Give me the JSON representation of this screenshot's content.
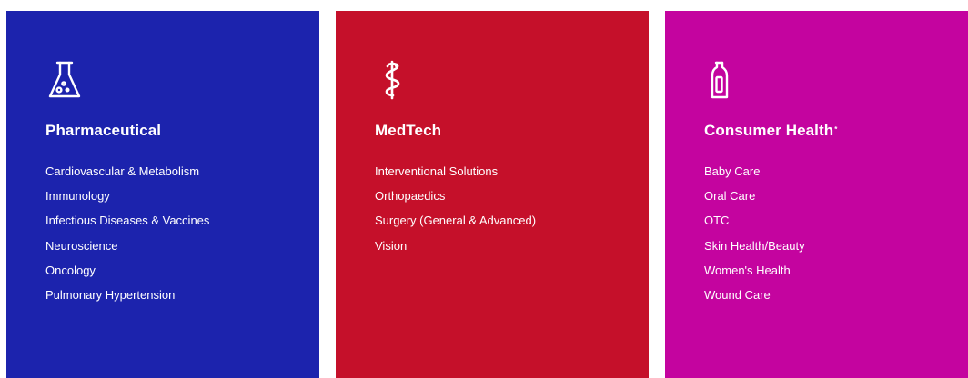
{
  "colors": {
    "pharmaceutical": "#1c23ad",
    "medtech": "#c5102a",
    "consumer_health": "#c4049f",
    "text": "#ffffff"
  },
  "panels": [
    {
      "icon": "flask-icon",
      "title": "Pharmaceutical",
      "items": [
        "Cardiovascular & Metabolism",
        "Immunology",
        "Infectious Diseases & Vaccines",
        "Neuroscience",
        "Oncology",
        "Pulmonary Hypertension"
      ]
    },
    {
      "icon": "caduceus-icon",
      "title": "MedTech",
      "items": [
        "Interventional Solutions",
        "Orthopaedics",
        "Surgery (General & Advanced)",
        "Vision"
      ]
    },
    {
      "icon": "bottle-icon",
      "title": "Consumer Health",
      "title_mark": "*",
      "items": [
        "Baby Care",
        "Oral Care",
        "OTC",
        "Skin Health/Beauty",
        "Women's Health",
        "Wound Care"
      ]
    }
  ]
}
